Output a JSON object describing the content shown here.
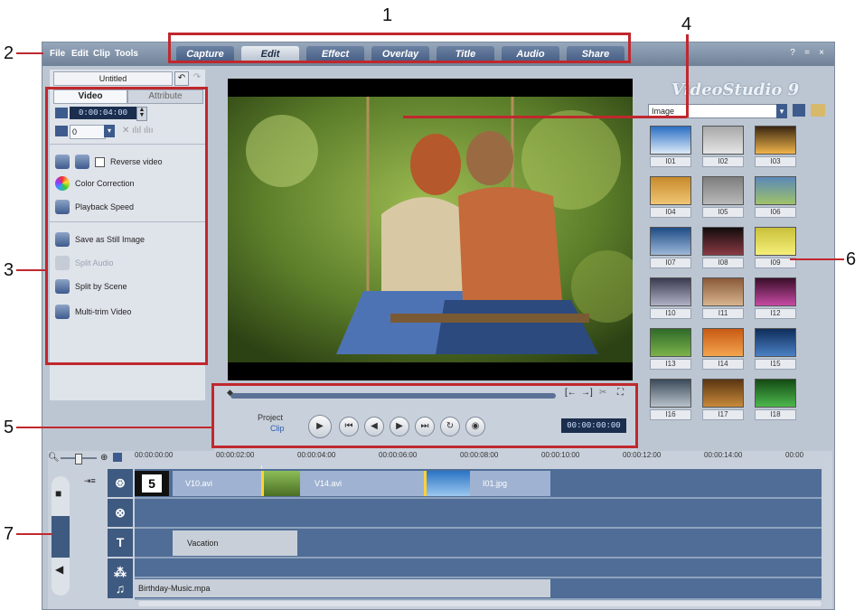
{
  "callouts": [
    "1",
    "2",
    "3",
    "4",
    "5",
    "6",
    "7"
  ],
  "menu": [
    "File",
    "Edit",
    "Clip",
    "Tools"
  ],
  "tabs": [
    "Capture",
    "Edit",
    "Effect",
    "Overlay",
    "Title",
    "Audio",
    "Share"
  ],
  "active_tab": "Edit",
  "window_buttons": [
    "?",
    "=",
    "×"
  ],
  "brand": "VideoStudio 9",
  "left_panel": {
    "project_name": "Untitled",
    "tab_video": "Video",
    "tab_attribute": "Attribute",
    "duration": "0:00:04:00",
    "volume": "0",
    "reverse_video": "Reverse video",
    "color_correction": "Color Correction",
    "playback_speed": "Playback Speed",
    "save_still": "Save as Still Image",
    "split_audio": "Split Audio",
    "split_by_scene": "Split by Scene",
    "multi_trim": "Multi-trim Video"
  },
  "navigation": {
    "project_label": "Project",
    "clip_label": "Clip",
    "timecode": "00:00:00:00"
  },
  "library": {
    "category": "Image",
    "items": [
      "I01",
      "I02",
      "I03",
      "I04",
      "I05",
      "I06",
      "I07",
      "I08",
      "I09",
      "I10",
      "I11",
      "I12",
      "I13",
      "I14",
      "I15",
      "I16",
      "I17",
      "I18"
    ]
  },
  "timeline": {
    "ruler": [
      "00:00:00:00",
      "00:00:02:00",
      "00:00:04:00",
      "00:00:06:00",
      "00:00:08:00",
      "00:00:10:00",
      "00:00:12:00",
      "00:00:14:00",
      "00:00"
    ],
    "video_clips": [
      "V10.avi",
      "V14.avi",
      "I01.jpg"
    ],
    "start_frame_number": "5",
    "title_clip": "Vacation",
    "music_clip": "Birthday-Music.mpa"
  },
  "colors": {
    "accent": "#c0282d",
    "window": "#bcc6d2",
    "track": "#4f6d96"
  }
}
